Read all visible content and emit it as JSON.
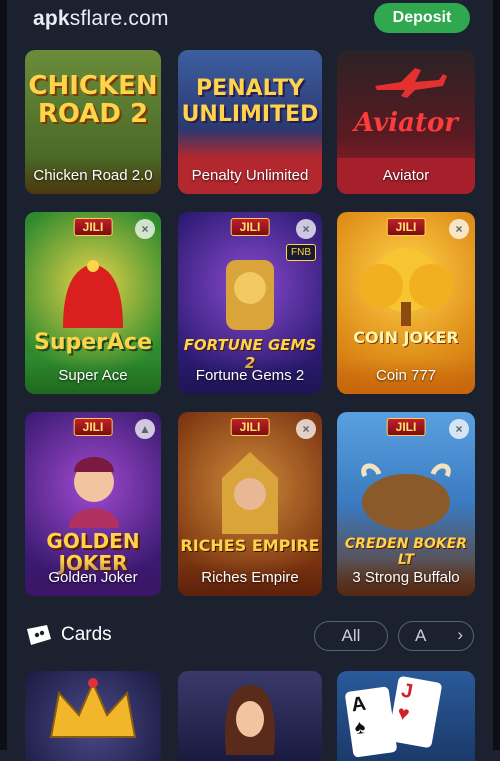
{
  "header": {
    "logo_bold": "apk",
    "logo_rest": "sflare.com",
    "deposit_label": "Deposit"
  },
  "games": [
    {
      "label": "Chicken Road 2.0",
      "art_title": "CHICKEN ROAD 2"
    },
    {
      "label": "Penalty Unlimited",
      "art_title": "PENALTY UNLIMITED"
    },
    {
      "label": "Aviator",
      "art_title": "Aviator"
    },
    {
      "label": "Super Ace",
      "art_title": "SuperAce",
      "badge": "JILI"
    },
    {
      "label": "Fortune Gems 2",
      "art_title": "FORTUNE GEMS 2",
      "badge": "JILI",
      "tag": "FNB"
    },
    {
      "label": "Coin 777",
      "art_title": "COIN JOKER",
      "badge": "JILI"
    },
    {
      "label": "Golden Joker",
      "art_title": "GOLDEN JOKER",
      "badge": "JILI"
    },
    {
      "label": "Riches Empire",
      "art_title": "RICHES EMPIRE",
      "badge": "JILI"
    },
    {
      "label": "3 Strong Buffalo",
      "art_title": "CREDEN BOKER LT",
      "badge": "JILI"
    }
  ],
  "section": {
    "title": "Cards",
    "filter_all": "All",
    "filter_a": "A",
    "chevron": "›"
  },
  "colors": {
    "background": "#1c2130",
    "deposit": "#2fa84f",
    "chicken": "#d9a43a",
    "penalty": "#3c4a7a",
    "aviator": "#b0212a",
    "superace": "#2e8a2e",
    "fortune": "#3a2a8a",
    "coin": "#e0901a",
    "golden": "#4a2a8a",
    "riches": "#7a3410",
    "buffalo": "#3a7ac0"
  }
}
